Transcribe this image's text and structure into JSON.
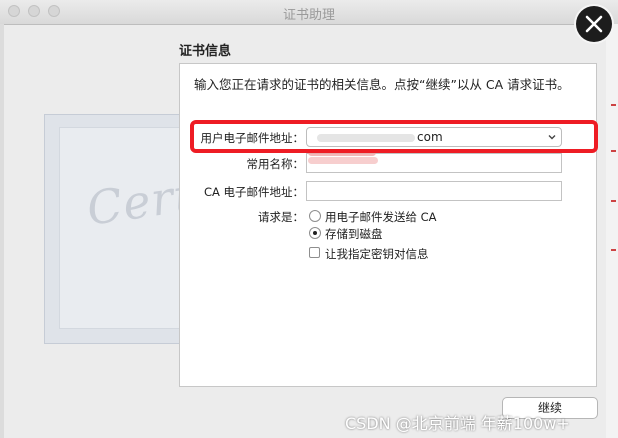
{
  "window": {
    "title": "证书助理"
  },
  "section": {
    "title": "证书信息"
  },
  "intro": {
    "text": "输入您正在请求的证书的相关信息。点按“继续”以从 CA 请求证书。"
  },
  "form": {
    "email_label": "用户电子邮件地址：",
    "email_value": "com",
    "name_label": "常用名称：",
    "name_value": "",
    "ca_email_label": "CA 电子邮件地址：",
    "ca_email_value": "",
    "request_label": "请求是：",
    "options": [
      {
        "label": "用电子邮件发送给 CA",
        "selected": false
      },
      {
        "label": "存储到磁盘",
        "selected": true
      }
    ],
    "checkbox_label": "让我指定密钥对信息",
    "checkbox_checked": false
  },
  "buttons": {
    "continue_label": "继续"
  },
  "art": {
    "script_text": "Certificate"
  },
  "watermark": {
    "text": "CSDN @北京前端 年薪100w+"
  },
  "colors": {
    "highlight": "#ee1c24",
    "redaction": "#f0a6a6"
  },
  "icons": {
    "close": "close-icon",
    "chevron": "chevron-down-icon"
  }
}
